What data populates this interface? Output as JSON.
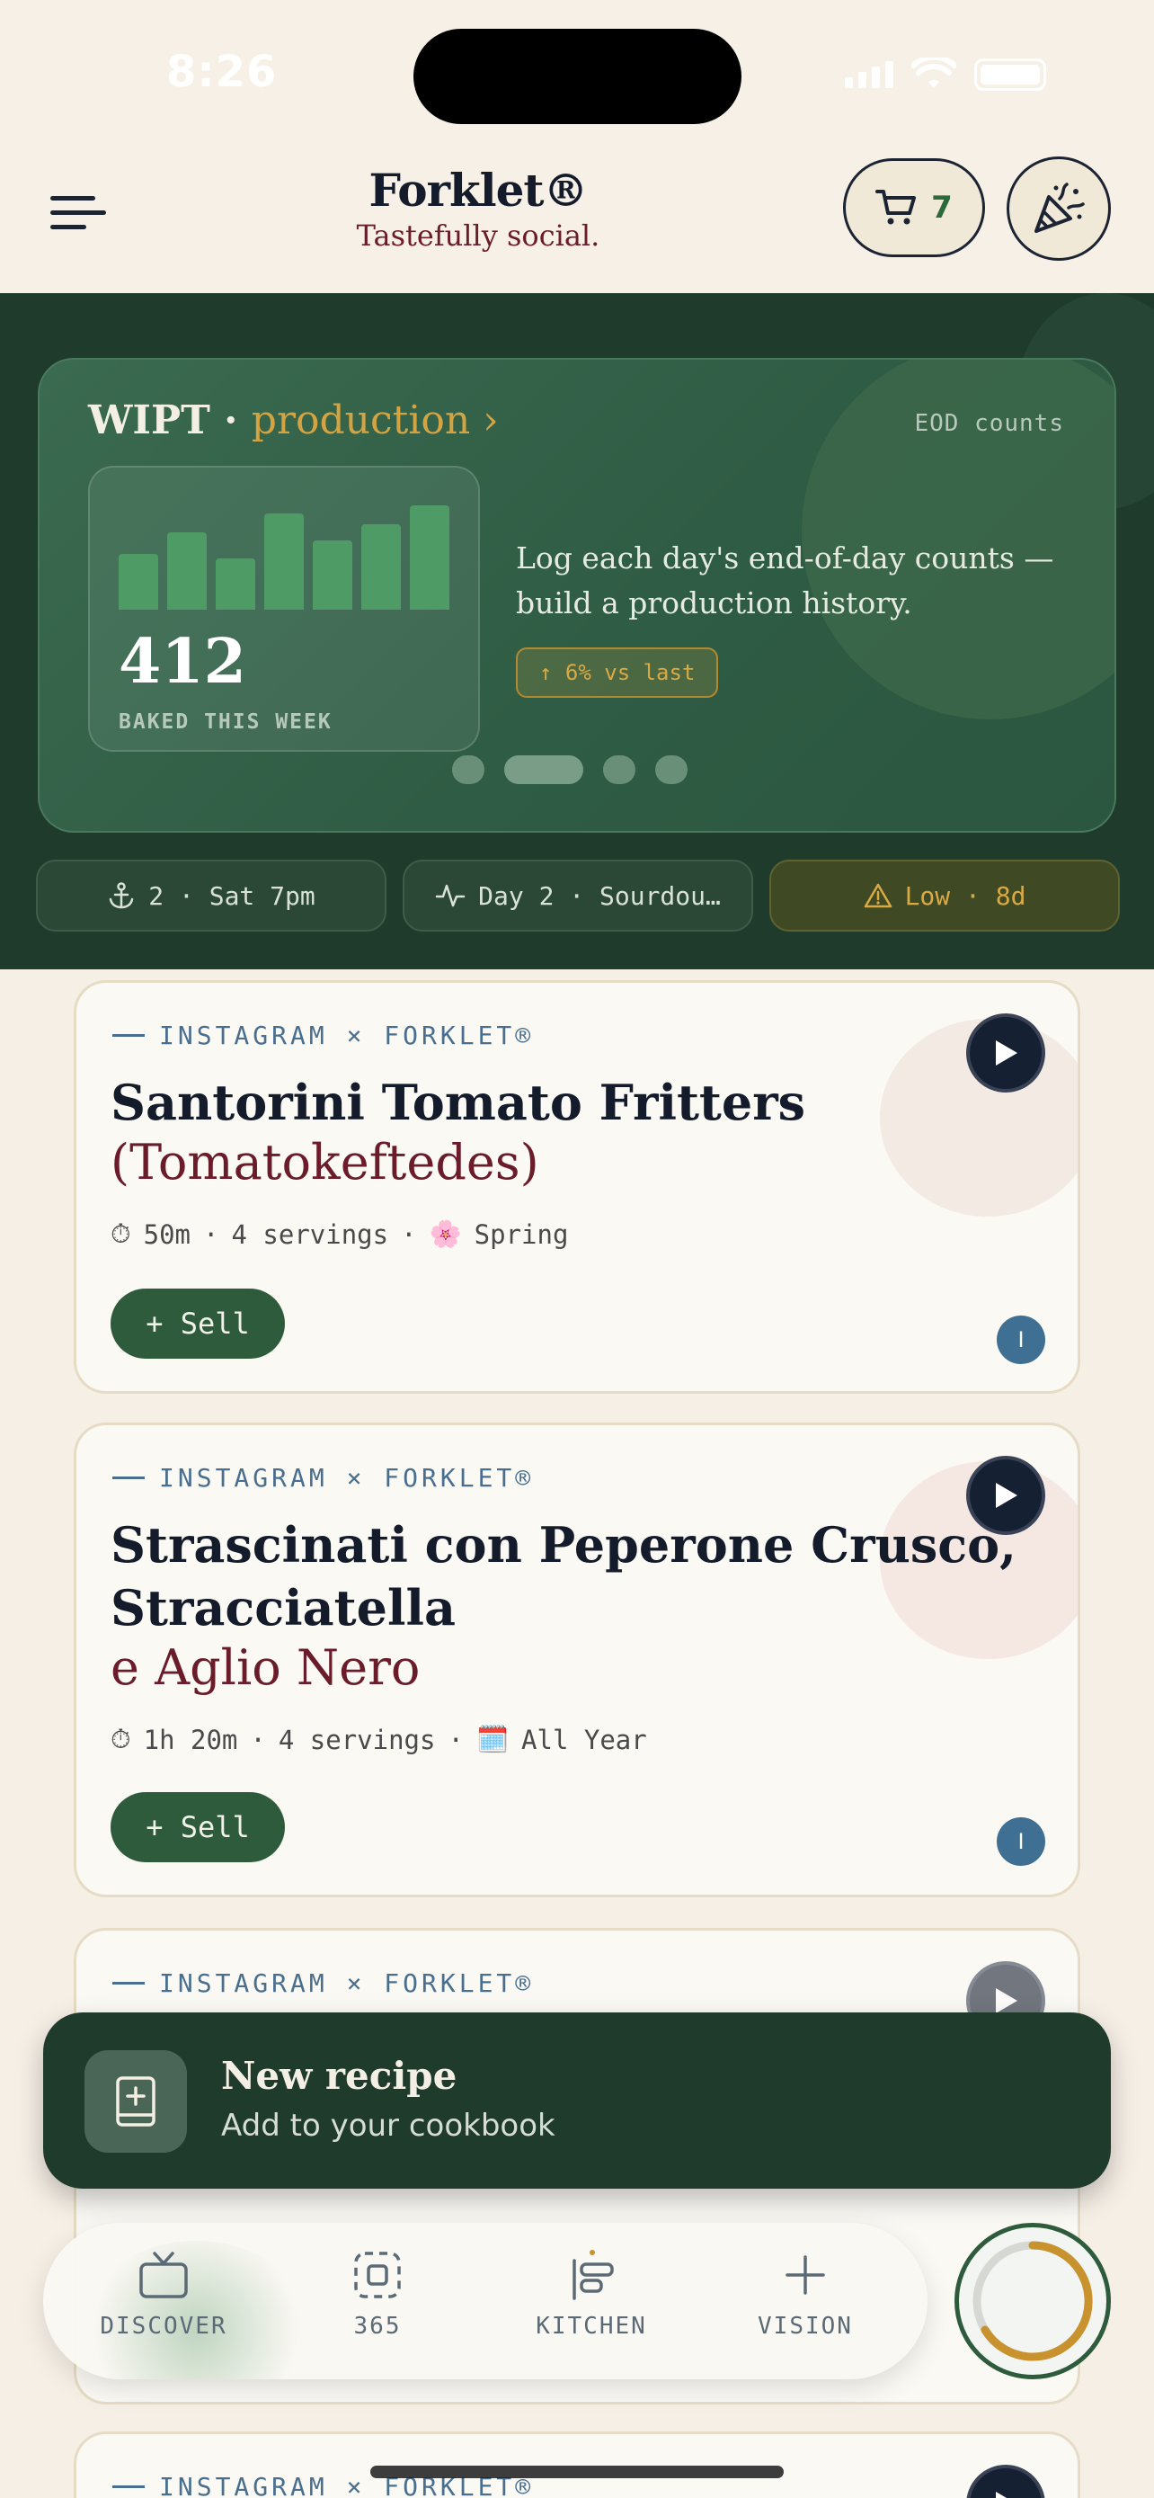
{
  "status": {
    "time": "8:26"
  },
  "header": {
    "brand": "Forklet®",
    "tagline": "Tastefully social.",
    "cart_count": "7"
  },
  "production": {
    "title_prefix": "WIPT · ",
    "title_accent": "production ›",
    "eod_label": "EOD counts",
    "weekly_bars": [
      42,
      58,
      38,
      72,
      52,
      64,
      78
    ],
    "count": "412",
    "count_label": "BAKED THIS WEEK",
    "description": "Log each day's end-of-day counts — build a production history.",
    "delta": "↑ 6% vs last",
    "carousel_pages": 4,
    "carousel_active": 1
  },
  "chips": [
    {
      "icon": "anchor-icon",
      "text": "2 · Sat 7pm"
    },
    {
      "icon": "activity-icon",
      "text": "Day 2 · Sourdou…"
    },
    {
      "icon": "warning-icon",
      "text": "Low · 8d"
    }
  ],
  "recipes": [
    {
      "source": "INSTAGRAM × FORKLET®",
      "title": "Santorini Tomato Fritters",
      "subtitle": "(Tomatokeftedes)",
      "time": "50m",
      "servings": "4 servings",
      "season_icon": "🌸",
      "season": "Spring",
      "sell": "+ Sell",
      "badge": "I"
    },
    {
      "source": "INSTAGRAM × FORKLET®",
      "title": "Strascinati con Peperone Crusco,",
      "title2": "Stracciatella",
      "subtitle": "e Aglio Nero",
      "time": "1h 20m",
      "servings": "4 servings",
      "season_icon": "🗓️",
      "season": "All Year",
      "sell": "+ Sell",
      "badge": "I"
    },
    {
      "source": "INSTAGRAM × FORKLET®"
    },
    {
      "source": "INSTAGRAM × FORKLET®"
    }
  ],
  "toast": {
    "title": "New recipe",
    "subtitle": "Add to your cookbook"
  },
  "nav": [
    {
      "label": "DISCOVER",
      "icon": "tv-icon"
    },
    {
      "label": "365",
      "icon": "scan-icon"
    },
    {
      "label": "KITCHEN",
      "icon": "kitchen-icon"
    },
    {
      "label": "VISION",
      "icon": "plus-icon"
    }
  ],
  "colors": {
    "brand_green": "#1f3b2c",
    "accent_gold": "#d4a443",
    "wine": "#6a1c2a",
    "navy": "#141c2c"
  }
}
